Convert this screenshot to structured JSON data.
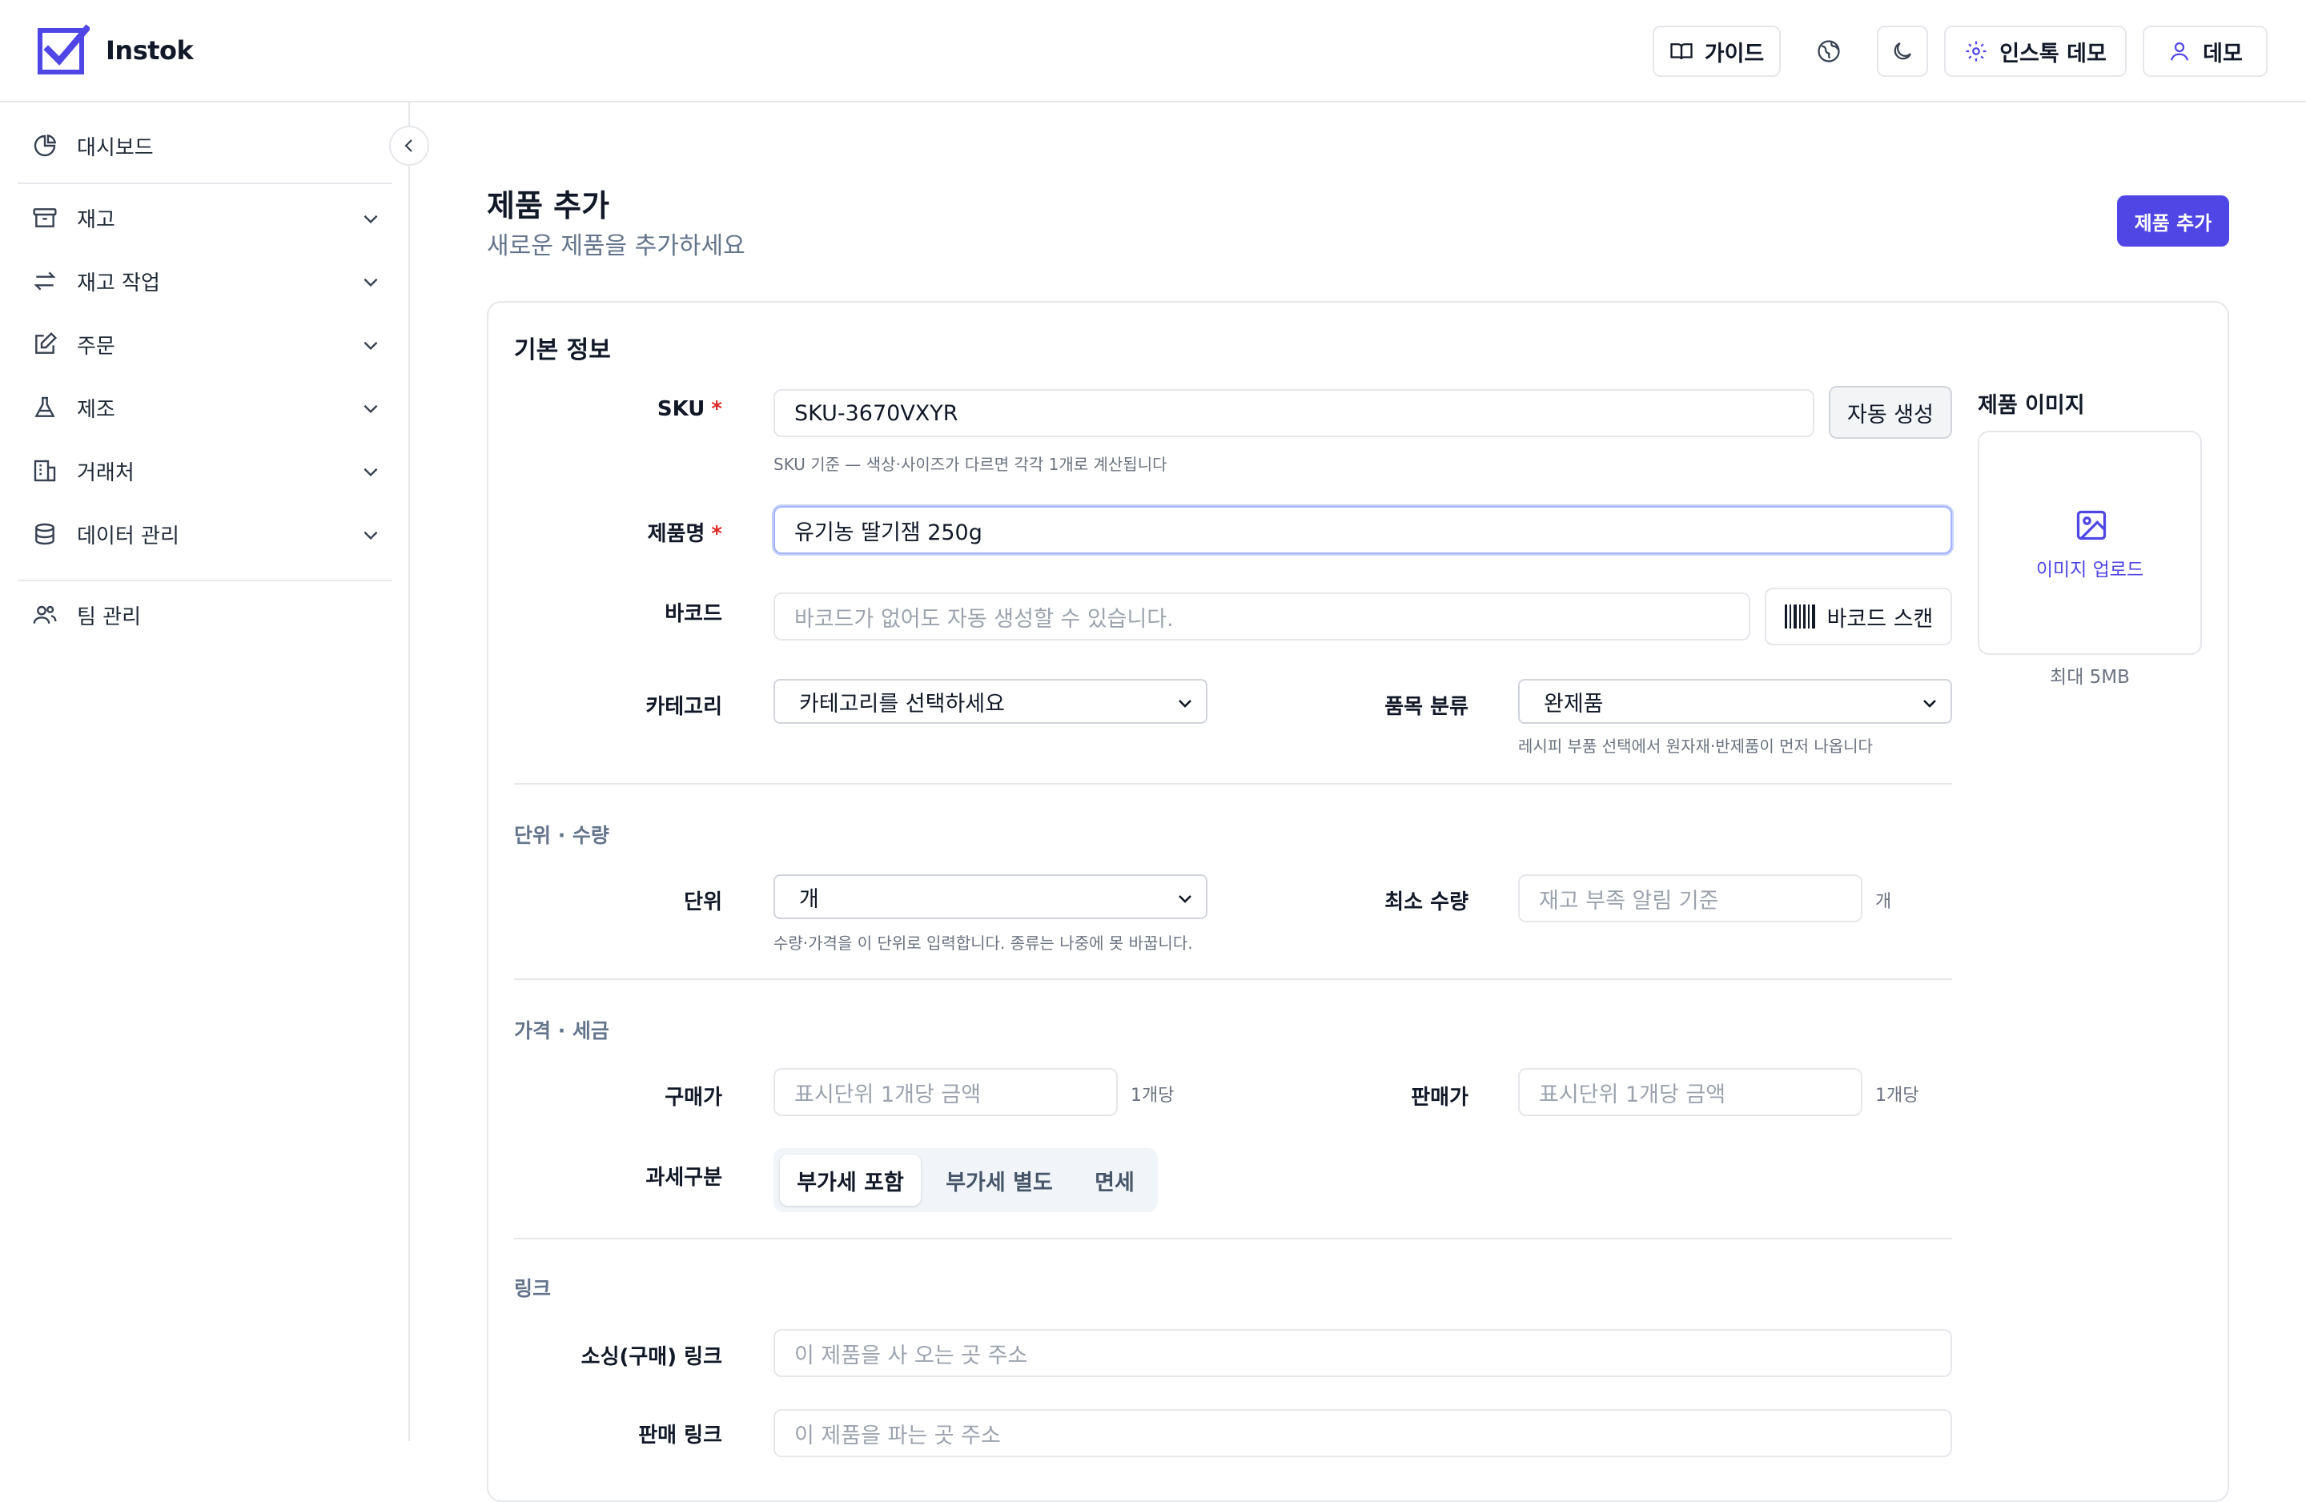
{
  "app": {
    "name": "Instok"
  },
  "header": {
    "guide_label": "가이드",
    "org_label": "인스톡 데모",
    "user_label": "데모"
  },
  "sidebar": {
    "items": [
      {
        "label": "대시보드",
        "icon": "pie-chart-icon"
      },
      {
        "label": "재고",
        "icon": "archive-box-icon"
      },
      {
        "label": "재고 작업",
        "icon": "arrows-swap-icon"
      },
      {
        "label": "주문",
        "icon": "edit-square-icon"
      },
      {
        "label": "제조",
        "icon": "flask-icon"
      },
      {
        "label": "거래처",
        "icon": "building-icon"
      },
      {
        "label": "데이터 관리",
        "icon": "database-icon"
      },
      {
        "label": "팀 관리",
        "icon": "users-icon"
      }
    ]
  },
  "page": {
    "title": "제품 추가",
    "subtitle": "새로운 제품을 추가하세요",
    "submit_label": "제품 추가"
  },
  "basic": {
    "title": "기본 정보",
    "sku_label": "SKU",
    "required_mark": "*",
    "sku_value": "SKU-3670VXYR",
    "autogen_label": "자동 생성",
    "sku_hint": "SKU 기준 — 색상·사이즈가 다르면 각각 1개로 계산됩니다",
    "name_label": "제품명",
    "name_value": "유기농 딸기잼 250g",
    "barcode_label": "바코드",
    "barcode_placeholder": "바코드가 없어도 자동 생성할 수 있습니다.",
    "barcode_scan_label": "바코드 스캔",
    "category_label": "카테고리",
    "category_value": "카테고리를 선택하세요",
    "item_type_label": "품목 분류",
    "item_type_value": "완제품",
    "item_type_hint": "레시피 부품 선택에서 원자재·반제품이 먼저 나옵니다"
  },
  "units": {
    "title": "단위 · 수량",
    "unit_label": "단위",
    "unit_value": "개",
    "unit_hint": "수량·가격을 이 단위로 입력합니다. 종류는 나중에 못 바꿉니다.",
    "min_qty_label": "최소 수량",
    "min_qty_placeholder": "재고 부족 알림 기준",
    "min_qty_suffix": "개"
  },
  "price": {
    "title": "가격 · 세금",
    "buy_label": "구매가",
    "buy_placeholder": "표시단위 1개당 금액",
    "buy_suffix": "1개당",
    "sell_label": "판매가",
    "sell_placeholder": "표시단위 1개당 금액",
    "sell_suffix": "1개당",
    "tax_label": "과세구분",
    "tax_options": [
      "부가세 포함",
      "부가세 별도",
      "면세"
    ],
    "tax_selected": "부가세 포함"
  },
  "links": {
    "title": "링크",
    "sourcing_label": "소싱(구매) 링크",
    "sourcing_placeholder": "이 제품을 사 오는 곳 주소",
    "sales_label": "판매 링크",
    "sales_placeholder": "이 제품을 파는 곳 주소"
  },
  "image": {
    "title": "제품 이미지",
    "upload_label": "이미지 업로드",
    "max_label": "최대 5MB"
  },
  "colors": {
    "accent": "#4f46e5",
    "required": "#dc2626",
    "border": "#e5e7eb",
    "muted": "#64748b"
  }
}
